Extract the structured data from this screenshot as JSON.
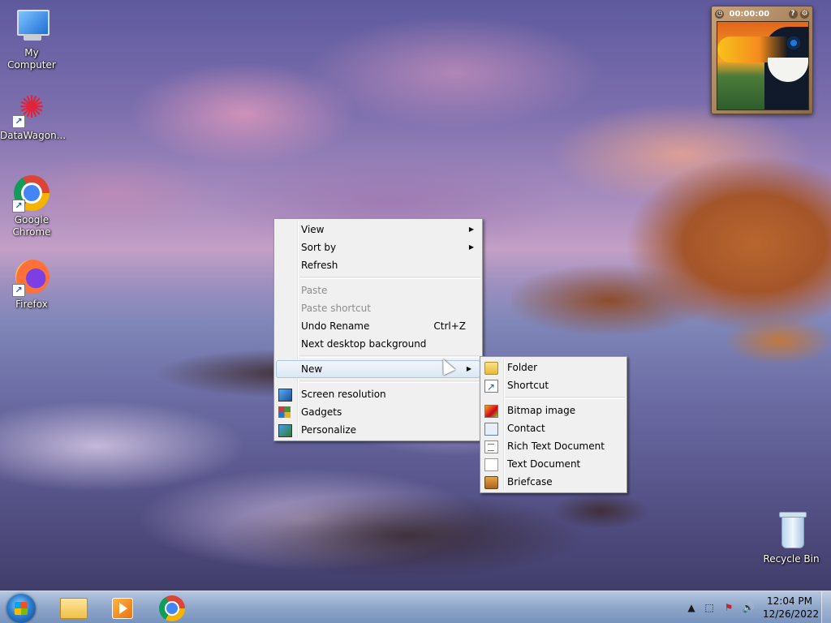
{
  "desktop_icons": [
    {
      "label": "My Computer",
      "icon": "computer-icon"
    },
    {
      "label": "DataWagon...",
      "icon": "datawagon-icon"
    },
    {
      "label": "Google Chrome",
      "icon": "chrome-icon"
    },
    {
      "label": "Firefox",
      "icon": "firefox-icon"
    },
    {
      "label": "Recycle Bin",
      "icon": "recycle-bin-icon"
    }
  ],
  "gadget": {
    "time": "00:00:00",
    "help": "?",
    "settings": "⚙"
  },
  "context_menu": {
    "items": [
      {
        "label": "View",
        "submenu": true
      },
      {
        "label": "Sort by",
        "submenu": true
      },
      {
        "label": "Refresh"
      },
      {
        "label": "Paste",
        "disabled": true
      },
      {
        "label": "Paste shortcut",
        "disabled": true
      },
      {
        "label": "Undo Rename",
        "shortcut": "Ctrl+Z"
      },
      {
        "label": "Next desktop background"
      },
      {
        "label": "New",
        "submenu": true,
        "highlighted": true
      },
      {
        "label": "Screen resolution",
        "icon": "screen-resolution-icon"
      },
      {
        "label": "Gadgets",
        "icon": "gadgets-icon"
      },
      {
        "label": "Personalize",
        "icon": "personalize-icon"
      }
    ]
  },
  "new_submenu": {
    "items": [
      {
        "label": "Folder",
        "icon": "folder-icon"
      },
      {
        "label": "Shortcut",
        "icon": "shortcut-icon"
      },
      {
        "label": "Bitmap image",
        "icon": "bitmap-icon"
      },
      {
        "label": "Contact",
        "icon": "contact-icon"
      },
      {
        "label": "Rich Text Document",
        "icon": "rich-text-icon"
      },
      {
        "label": "Text Document",
        "icon": "text-document-icon"
      },
      {
        "label": "Briefcase",
        "icon": "briefcase-icon"
      }
    ]
  },
  "taskbar": {
    "pinned": [
      "windows-explorer-icon",
      "media-player-icon",
      "chrome-icon"
    ],
    "tray": {
      "show_hidden": "▲",
      "network": "⬚",
      "flag": "⚑",
      "volume": "🔊"
    },
    "clock": {
      "time": "12:04 PM",
      "date": "12/26/2022"
    }
  }
}
